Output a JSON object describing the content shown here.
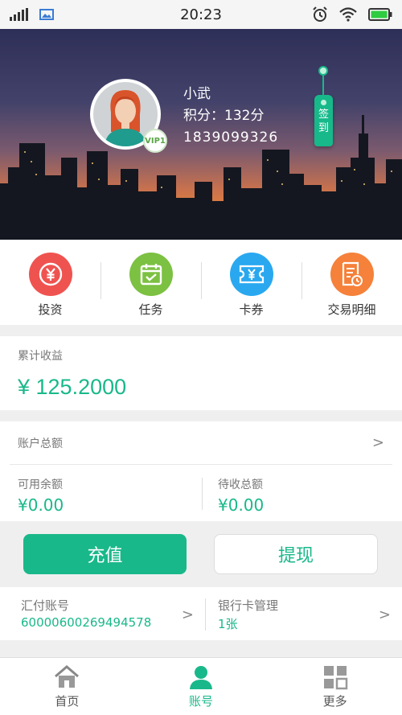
{
  "status_bar": {
    "time": "20:23",
    "icons": [
      "signal-icon",
      "image-icon",
      "alarm-icon",
      "wifi-icon",
      "battery-icon"
    ]
  },
  "profile": {
    "name": "小武",
    "points": "积分：132分",
    "phone": "1839099326",
    "vip_label": "VIP1",
    "sign_in_label": "签到"
  },
  "quick_menu": [
    {
      "label": "投资",
      "icon": "yuan-icon",
      "color": "#ef5350"
    },
    {
      "label": "任务",
      "icon": "calendar-check-icon",
      "color": "#7cc142"
    },
    {
      "label": "卡券",
      "icon": "coupon-icon",
      "color": "#29a8f0"
    },
    {
      "label": "交易明细",
      "icon": "document-clock-icon",
      "color": "#f5813a"
    }
  ],
  "earnings": {
    "label": "累计收益",
    "value": "¥ 125.2000"
  },
  "account": {
    "total_label": "账户总额",
    "available_label": "可用余额",
    "available_value": "¥0.00",
    "pending_label": "待收总额",
    "pending_value": "¥0.00"
  },
  "actions": {
    "recharge": "充值",
    "withdraw": "提现"
  },
  "bank": {
    "huifu_label": "汇付账号",
    "huifu_value": "60000600269494578",
    "card_label": "银行卡管理",
    "card_value": "1张"
  },
  "bottom_nav": [
    {
      "label": "首页",
      "icon": "home-icon",
      "active": false
    },
    {
      "label": "账号",
      "icon": "user-icon",
      "active": true
    },
    {
      "label": "更多",
      "icon": "grid-icon",
      "active": false
    }
  ],
  "colors": {
    "accent": "#19b88a",
    "background": "#efefef"
  }
}
